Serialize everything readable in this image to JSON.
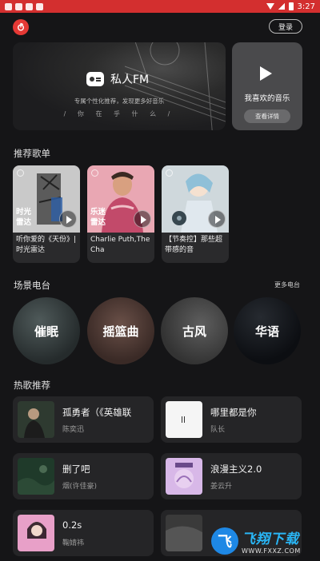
{
  "status_bar": {
    "time": "3:27"
  },
  "header": {
    "login_label": "登录"
  },
  "banner": {
    "fm_title": "私人FM",
    "fm_subtitle": "专属个性化推荐，发现更多好音乐",
    "fm_slogan": "/ 你 在 乎 什 么 /",
    "fav_label": "我喜欢的音乐",
    "fav_button": "查看详情"
  },
  "playlists": {
    "title": "推荐歌单",
    "items": [
      {
        "overlay": "时光\n雷达",
        "label": "听你爱的《天份》|时光雷达"
      },
      {
        "overlay": "乐迷\n雷达",
        "label": "Charlie Puth,The Cha"
      },
      {
        "overlay": "",
        "label": "【节奏控】那些超带感的音"
      }
    ]
  },
  "scenes": {
    "title": "场景电台",
    "more": "更多电台",
    "items": [
      "催眠",
      "摇篮曲",
      "古风",
      "华语"
    ]
  },
  "hot_songs": {
    "title": "热歌推荐",
    "items": [
      {
        "title": "孤勇者（《英雄联",
        "artist": "陈奕迅"
      },
      {
        "title": "哪里都是你",
        "artist": "队长"
      },
      {
        "title": "删了吧",
        "artist": "烟(许佳豪)"
      },
      {
        "title": "浪漫主义2.0",
        "artist": "姜云升"
      },
      {
        "title": "0.2s",
        "artist": "鞠婧祎"
      },
      {
        "title": "",
        "artist": ""
      }
    ]
  },
  "watermark": {
    "main": "飞翔下载",
    "url": "WWW.FXXZ.COM"
  }
}
